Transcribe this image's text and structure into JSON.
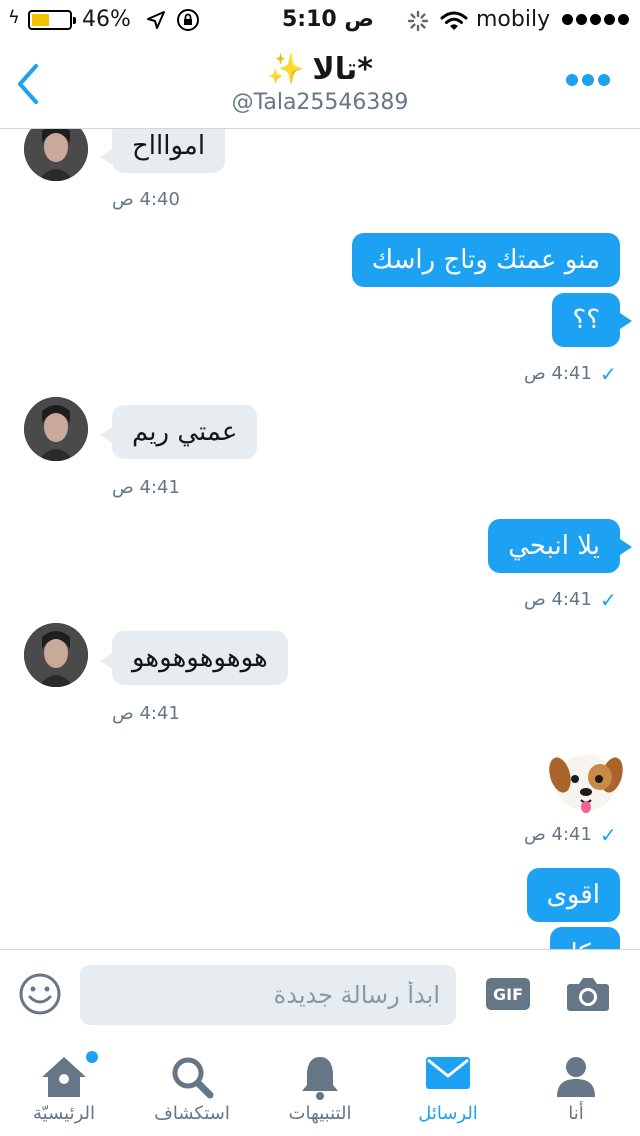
{
  "status_bar": {
    "battery_percent": "46%",
    "battery_level": 0.46,
    "time": "5:10 ص",
    "carrier": "mobily"
  },
  "header": {
    "title": "تالا*",
    "handle": "@Tala25546389"
  },
  "messages": [
    {
      "direction": "in",
      "text": "امواااح",
      "time": "4:40 ص"
    },
    {
      "direction": "out",
      "text": "منو عمتك وتاج راسك"
    },
    {
      "direction": "out",
      "text": "؟؟",
      "time": "4:41 ص"
    },
    {
      "direction": "in",
      "text": "عمتي ريم",
      "time": "4:41 ص"
    },
    {
      "direction": "out",
      "text": "يلا انبحي",
      "time": "4:41 ص"
    },
    {
      "direction": "in",
      "text": "هوهوهوهوهو",
      "time": "4:41 ص"
    },
    {
      "direction": "out",
      "emoji": "dog-face-emoji",
      "time": "4:41 ص"
    },
    {
      "direction": "out",
      "text": "اقوى"
    },
    {
      "direction": "out",
      "text": "بكا"
    }
  ],
  "composer": {
    "placeholder": "ابدأ رسالة جديدة",
    "gif_label": "GIF"
  },
  "tabs": [
    {
      "label": "الرئيسيّة",
      "icon": "home-icon",
      "has_dot": true,
      "active": false
    },
    {
      "label": "استكشاف",
      "icon": "search-icon",
      "active": false
    },
    {
      "label": "التنبيهات",
      "icon": "bell-icon",
      "active": false
    },
    {
      "label": "الرسائل",
      "icon": "envelope-icon",
      "active": true
    },
    {
      "label": "أنا",
      "icon": "profile-icon",
      "active": false
    }
  ],
  "colors": {
    "accent": "#1da1f2",
    "incoming_bubble": "#e6ecf0",
    "muted": "#657786"
  }
}
